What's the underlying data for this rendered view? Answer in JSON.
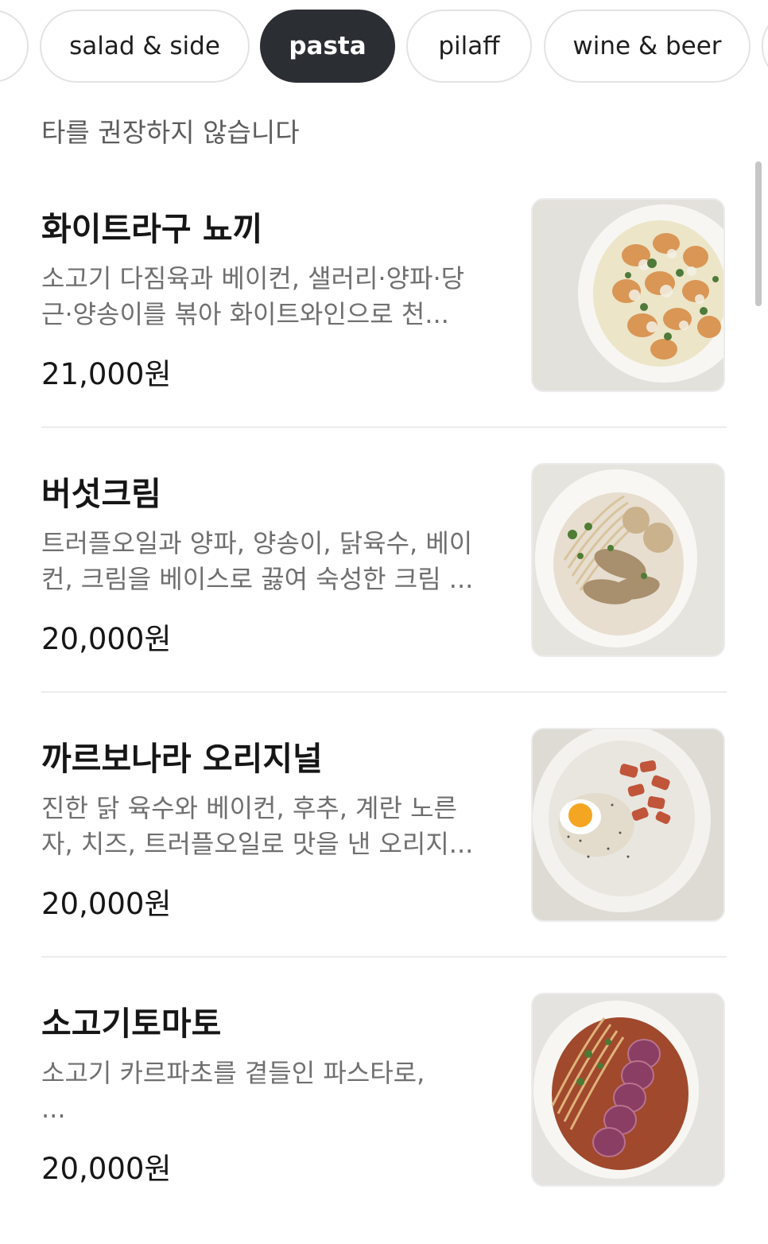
{
  "categories": [
    {
      "label": ""
    },
    {
      "label": "salad & side"
    },
    {
      "label": "pasta",
      "active": true
    },
    {
      "label": "pilaff"
    },
    {
      "label": "wine & beer"
    },
    {
      "label": ""
    }
  ],
  "notice": "타를 권장하지 않습니다",
  "menu_items": [
    {
      "name": "화이트라구 뇨끼",
      "desc_line1": "소고기 다짐육과 베이컨, 샐러리·양파·당",
      "desc_line2": "근·양송이를  볶아 화이트와인으로 천...",
      "price": "21,000원",
      "photo_icon": "white-ragu-gnocchi-dish"
    },
    {
      "name": "버섯크림",
      "desc_line1": "트러플오일과 양파, 양송이, 닭육수, 베이",
      "desc_line2": "컨, 크림을 베이스로 끓여 숙성한 크림 ...",
      "price": "20,000원",
      "photo_icon": "mushroom-cream-pasta-dish"
    },
    {
      "name": "까르보나라 오리지널",
      "desc_line1": "진한 닭 육수와 베이컨, 후추, 계란 노른",
      "desc_line2": "자, 치즈, 트러플오일로 맛을 낸 오리지...",
      "price": "20,000원",
      "photo_icon": "carbonara-dish"
    },
    {
      "name": "소고기토마토",
      "desc_line1": "소고기 카르파초를 곁들인 파스타로,",
      "desc_line2": " ...",
      "price": "20,000원",
      "photo_icon": "beef-tomato-pasta-dish"
    }
  ],
  "colors": {
    "active_chip": "#2b2e33",
    "chip_border": "#e3e3e3",
    "desc_text": "#6f6f6f",
    "divider": "#ececec"
  }
}
